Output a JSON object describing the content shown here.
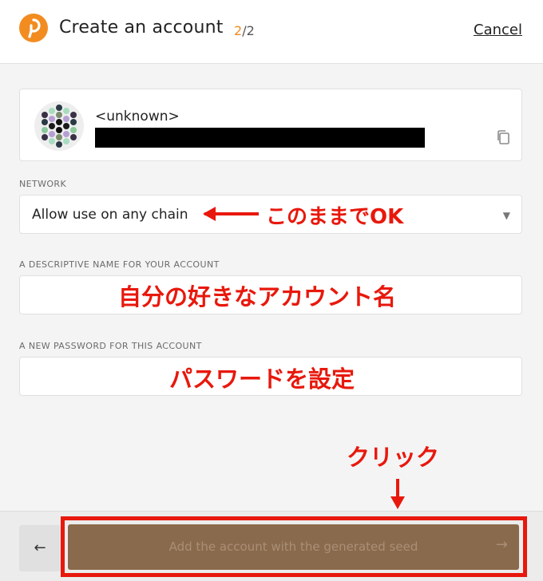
{
  "header": {
    "title": "Create an account",
    "step_current": "2",
    "step_total": "/2",
    "cancel_label": "Cancel",
    "logo_icon": "polkadot-logo-icon",
    "accent_color": "#f28c20"
  },
  "account": {
    "name": "<unknown>",
    "copy_icon": "copy-icon"
  },
  "fields": {
    "network_label": "NETWORK",
    "network_value": "Allow use on any chain",
    "name_label": "A DESCRIPTIVE NAME FOR YOUR ACCOUNT",
    "name_value": "",
    "password_label": "A NEW PASSWORD FOR THIS ACCOUNT",
    "password_value": ""
  },
  "annotations": {
    "network_note": "このままでOK",
    "name_note": "自分の好きなアカウント名",
    "password_note": "パスワードを設定",
    "click_note": "クリック",
    "color": "#e8180c"
  },
  "footer": {
    "back_icon": "arrow-left-icon",
    "submit_label": "Add the account with the generated seed",
    "submit_icon": "arrow-right-icon"
  }
}
